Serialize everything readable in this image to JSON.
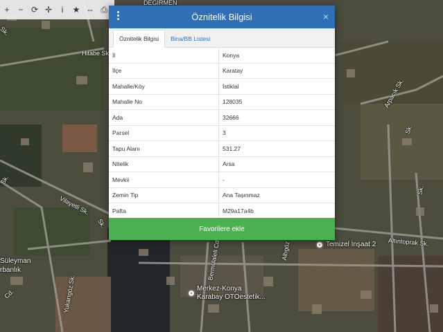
{
  "toolbar": {
    "icons": [
      "zoom-in-icon",
      "zoom-out-icon",
      "refresh-icon",
      "locate-icon",
      "info-icon",
      "star-icon",
      "measure-icon",
      "print-icon"
    ],
    "glyphs": [
      "+",
      "−",
      "⟳",
      "✛",
      "i",
      "★",
      "⇔",
      "⎙"
    ]
  },
  "map": {
    "streets": [
      "Hitabe Sk.",
      "Sk.",
      "Vilayetli Sk.",
      "Arpacık Sk.",
      "Altıntoprak Sk.",
      "Bermülaleli Cd.",
      "Altıgöz Sk.",
      "Yukarıgöz Sk.",
      "Cd.",
      "Sk.",
      "DEĞİRMEN",
      "Sk.",
      "Sk.",
      "Sk."
    ],
    "pois": [
      "Temizel İnşaat 2",
      "Merkez-Konya Karabay OTOestetik...",
      "Süleyman",
      "rbanlık"
    ]
  },
  "dialog": {
    "title": "Öznitelik Bilgisi",
    "close": "×",
    "tabs": [
      "Öznitelik Bilgisi",
      "Bina/BB Listesi"
    ],
    "rows": [
      {
        "k": "İl",
        "v": "Konya"
      },
      {
        "k": "İlçe",
        "v": "Karatay"
      },
      {
        "k": "Mahalle/Köy",
        "v": "İstiklal"
      },
      {
        "k": "Mahalle No",
        "v": "128035"
      },
      {
        "k": "Ada",
        "v": "32666"
      },
      {
        "k": "Parsel",
        "v": "3"
      },
      {
        "k": "Tapu Alanı",
        "v": "531.27"
      },
      {
        "k": "Nitelik",
        "v": "Arsa"
      },
      {
        "k": "Mevkii",
        "v": "-"
      },
      {
        "k": "Zemin Tip",
        "v": "Ana Taşınmaz"
      },
      {
        "k": "Pafta",
        "v": "M29a17a4b"
      }
    ],
    "favorite_button": "Favorilere ekle"
  }
}
